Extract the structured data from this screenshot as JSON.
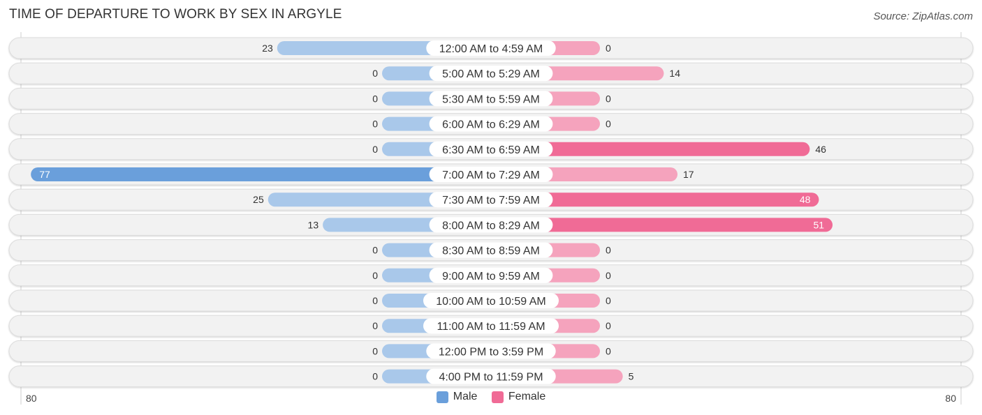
{
  "title": "TIME OF DEPARTURE TO WORK BY SEX IN ARGYLE",
  "source": "Source: ZipAtlas.com",
  "colors": {
    "male": "#6a9fdb",
    "male_light": "#a9c8ea",
    "female": "#f06b96",
    "female_light": "#f5a3bd",
    "track": "#f2f2f2"
  },
  "legend": [
    {
      "name": "Male",
      "color": "#6a9fdb"
    },
    {
      "name": "Female",
      "color": "#f06b96"
    }
  ],
  "chart_data": {
    "type": "bar",
    "orientation": "horizontal-diverging",
    "title": "TIME OF DEPARTURE TO WORK BY SEX IN ARGYLE",
    "categories": [
      "12:00 AM to 4:59 AM",
      "5:00 AM to 5:29 AM",
      "5:30 AM to 5:59 AM",
      "6:00 AM to 6:29 AM",
      "6:30 AM to 6:59 AM",
      "7:00 AM to 7:29 AM",
      "7:30 AM to 7:59 AM",
      "8:00 AM to 8:29 AM",
      "8:30 AM to 8:59 AM",
      "9:00 AM to 9:59 AM",
      "10:00 AM to 10:59 AM",
      "11:00 AM to 11:59 AM",
      "12:00 PM to 3:59 PM",
      "4:00 PM to 11:59 PM"
    ],
    "series": [
      {
        "name": "Male",
        "values": [
          23,
          0,
          0,
          0,
          0,
          77,
          25,
          13,
          0,
          0,
          0,
          0,
          0,
          0
        ]
      },
      {
        "name": "Female",
        "values": [
          0,
          14,
          0,
          0,
          46,
          17,
          48,
          51,
          0,
          0,
          0,
          0,
          0,
          5
        ]
      }
    ],
    "axis": {
      "left_label": "80",
      "right_label": "80",
      "range": [
        -80,
        80
      ]
    },
    "legend_position": "bottom-center",
    "grid": false
  }
}
